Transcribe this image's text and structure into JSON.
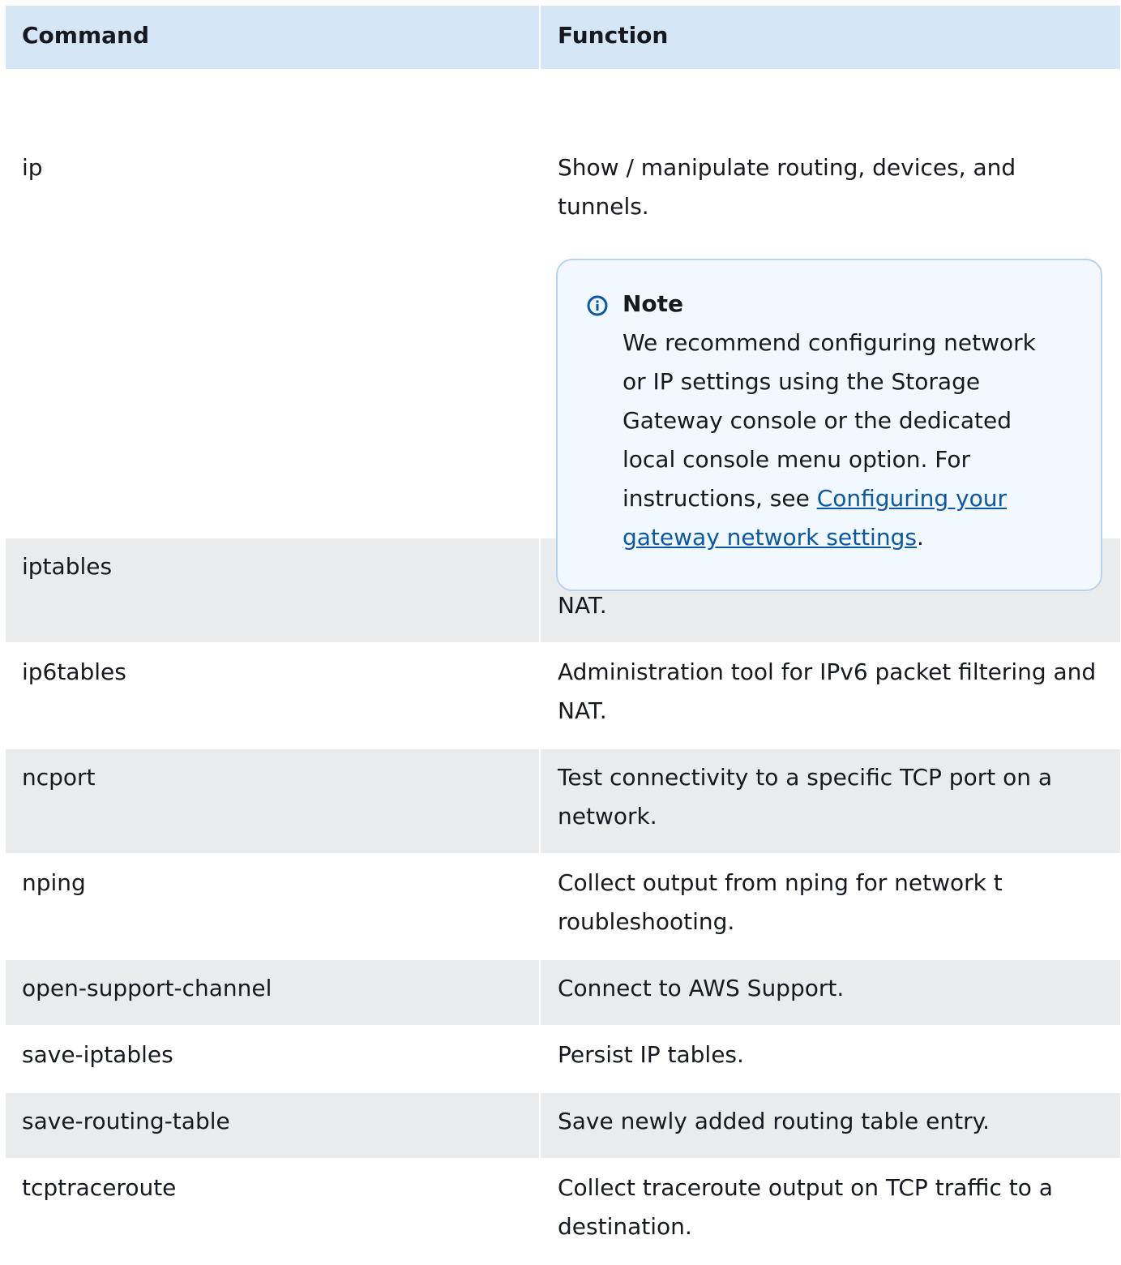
{
  "table": {
    "headers": {
      "command": "Command",
      "function": "Function"
    },
    "rows": [
      {
        "command": "ip",
        "function": "Show / manipulate routing, devices, and tunnels.",
        "note": {
          "icon": "info-icon",
          "title": "Note",
          "text_before_link": "We recommend configuring network or IP settings using  the Storage Gateway console or the dedicated local console menu  option. For instructions, see ",
          "link_text": "Configuring your gateway network   settings",
          "text_after_link": "."
        }
      },
      {
        "command": "iptables",
        "function": "Administration tool for IPv4 packet filtering and  NAT."
      },
      {
        "command": "ip6tables",
        "function": "Administration tool for IPv6 packet filtering and  NAT."
      },
      {
        "command": "ncport",
        "function": "Test connectivity to a specific TCP port on a  network."
      },
      {
        "command": "nping",
        "function": "Collect output from nping for network  t roubleshooting."
      },
      {
        "command": "open-support-channel",
        "function": "Connect to AWS Support."
      },
      {
        "command": "save-iptables",
        "function": "Persist IP tables."
      },
      {
        "command": "save-routing-table",
        "function": "Save newly added routing table entry."
      },
      {
        "command": "tcptraceroute",
        "function": "Collect traceroute output on TCP traffic to a  destination."
      }
    ]
  },
  "colors": {
    "header_bg": "#d5e6f7",
    "row_alt_bg": "#e9ebed",
    "note_bg": "#f1f8ff",
    "note_border": "#b9d3ee",
    "link": "#0a58a5",
    "info_icon": "#0a58a5"
  }
}
